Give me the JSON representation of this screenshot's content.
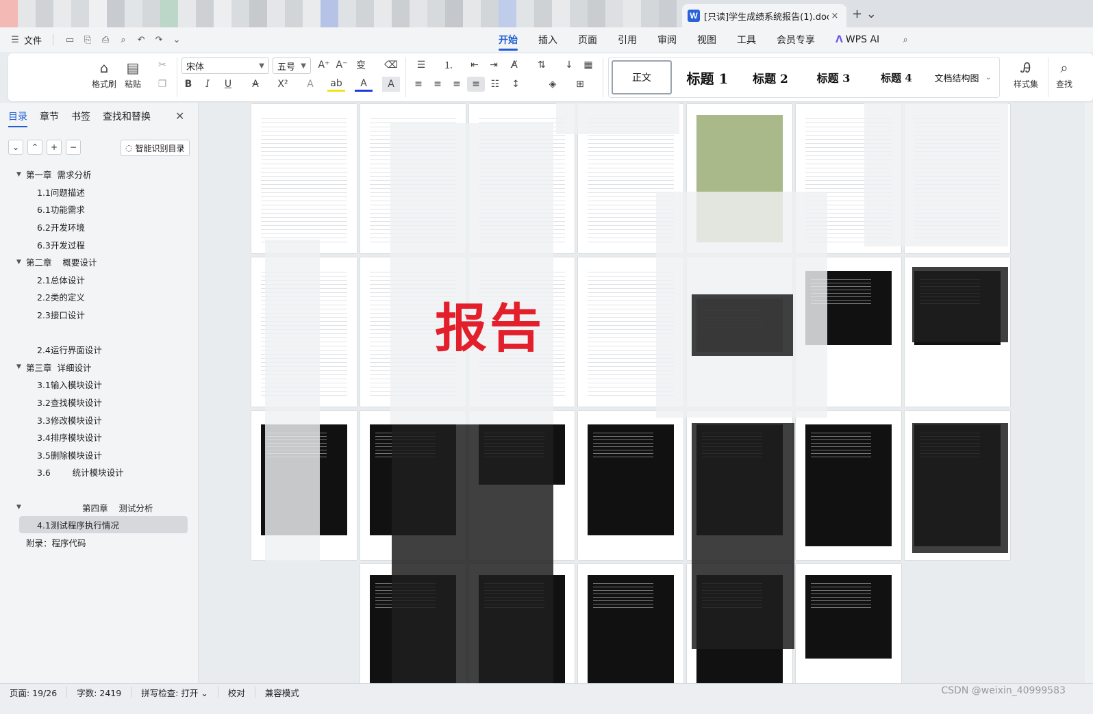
{
  "doc_tab": {
    "title": "[只读]学生成绩系统报告(1).doc",
    "close": "×",
    "new_tab": "+ ⌄"
  },
  "menu": {
    "file": "文件",
    "tabs": [
      "开始",
      "插入",
      "页面",
      "引用",
      "审阅",
      "视图",
      "工具",
      "会员专享"
    ],
    "active_tab": "开始",
    "ai_label": "WPS AI"
  },
  "ribbon": {
    "format_painter": "格式刷",
    "paste": "粘贴",
    "font": "宋体",
    "size": "五号",
    "styles": {
      "normal": "正文",
      "h1": "标题 1",
      "h2": "标题 2",
      "h3": "标题 3",
      "h4": "标题 4",
      "map": "文档结构图"
    },
    "style_set": "样式集",
    "find": "查找"
  },
  "sidebar": {
    "tabs": [
      "目录",
      "章节",
      "书签",
      "查找和替换"
    ],
    "active_tab": "目录",
    "smart_btn": "智能识别目录",
    "toc": [
      {
        "text": "第一章  需求分析",
        "level": 1,
        "collapsible": true
      },
      {
        "text": "1.1问题描述",
        "level": 2
      },
      {
        "text": "6.1功能需求",
        "level": 2
      },
      {
        "text": "6.2开发环境",
        "level": 2
      },
      {
        "text": "6.3开发过程",
        "level": 2
      },
      {
        "text": "第二章    概要设计",
        "level": 1,
        "collapsible": true
      },
      {
        "text": "2.1总体设计",
        "level": 2
      },
      {
        "text": "2.2类的定义",
        "level": 2
      },
      {
        "text": "2.3接口设计",
        "level": 2
      },
      {
        "text": "",
        "level": 2
      },
      {
        "text": "2.4运行界面设计",
        "level": 2
      },
      {
        "text": "第三章  详细设计",
        "level": 1,
        "collapsible": true
      },
      {
        "text": "3.1输入模块设计",
        "level": 2
      },
      {
        "text": "3.2查找模块设计",
        "level": 2
      },
      {
        "text": "3.3修改模块设计",
        "level": 2
      },
      {
        "text": "3.4排序模块设计",
        "level": 2
      },
      {
        "text": "3.5删除模块设计",
        "level": 2
      },
      {
        "text": "3.6        统计模块设计",
        "level": 2
      },
      {
        "text": "",
        "level": 2
      },
      {
        "text": "第四章    测试分析",
        "level": "center",
        "collapsible": true
      },
      {
        "text": "4.1测试程序执行情况",
        "level": 2,
        "selected": true
      },
      {
        "text": "附录：程序代码",
        "level": 1
      }
    ]
  },
  "canvas": {
    "watermark": "报告"
  },
  "status": {
    "page": "页面: 19/26",
    "words": "字数: 2419",
    "spell": "拼写检查: 打开 ⌄",
    "proof": "校对",
    "compat": "兼容模式",
    "credit": "CSDN @weixin_40999583"
  },
  "colors": {
    "accent": "#1f5ed6",
    "watermark": "#e21f2b"
  }
}
